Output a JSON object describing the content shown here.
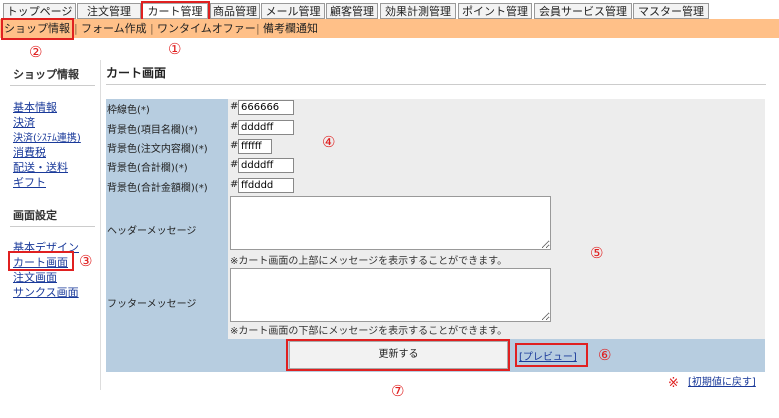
{
  "top_tabs": [
    {
      "label": "トップページ"
    },
    {
      "label": "注文管理"
    },
    {
      "label": "カート管理",
      "active": true
    },
    {
      "label": "商品管理"
    },
    {
      "label": "メール管理"
    },
    {
      "label": "顧客管理"
    },
    {
      "label": "効果計測管理"
    },
    {
      "label": "ポイント管理"
    },
    {
      "label": "会員サービス管理"
    },
    {
      "label": "マスター管理"
    }
  ],
  "sub_nav": {
    "items": [
      "ショップ情報",
      "フォーム作成",
      "ワンタイムオファー",
      "備考欄通知"
    ],
    "separator": "|"
  },
  "sidebar": {
    "section1_title": "ショップ情報",
    "section1_items": [
      "基本情報",
      "決済",
      "決済(ｼｽﾃﾑ連携)",
      "消費税",
      "配送・送料",
      "ギフト"
    ],
    "section2_title": "画面設定",
    "section2_items": [
      "基本デザイン",
      "カート画面",
      "注文画面",
      "サンクス画面"
    ]
  },
  "main": {
    "title": "カート画面",
    "hash_symbol": "#",
    "colors": [
      {
        "label": "枠線色(*)",
        "value": "666666"
      },
      {
        "label": "背景色(項目名欄)(*)",
        "value": "ddddff"
      },
      {
        "label": "背景色(注文内容欄)(*)",
        "value": "ffffff"
      },
      {
        "label": "背景色(合計欄)(*)",
        "value": "ddddff"
      },
      {
        "label": "背景色(合計金額欄)(*)",
        "value": "ffdddd"
      }
    ],
    "header_message": {
      "label": "ヘッダーメッセージ",
      "value": "",
      "note": "※カート画面の上部にメッセージを表示することができます。"
    },
    "footer_message": {
      "label": "フッターメッセージ",
      "value": "",
      "note": "※カート画面の下部にメッセージを表示することができます。"
    },
    "update_button": "更新する",
    "preview_link": "[プレビュー]",
    "reset_link": "[初期値に戻す]",
    "reset_mark": "※"
  },
  "annotations": {
    "n1": "①",
    "n2": "②",
    "n3": "③",
    "n4": "④",
    "n5": "⑤",
    "n6": "⑥",
    "n7": "⑦"
  },
  "colors": {
    "accent_red": "#e02020",
    "subnav_bg": "#ffc088",
    "label_bg": "#b7cde0",
    "link": "#1a3a9a"
  }
}
